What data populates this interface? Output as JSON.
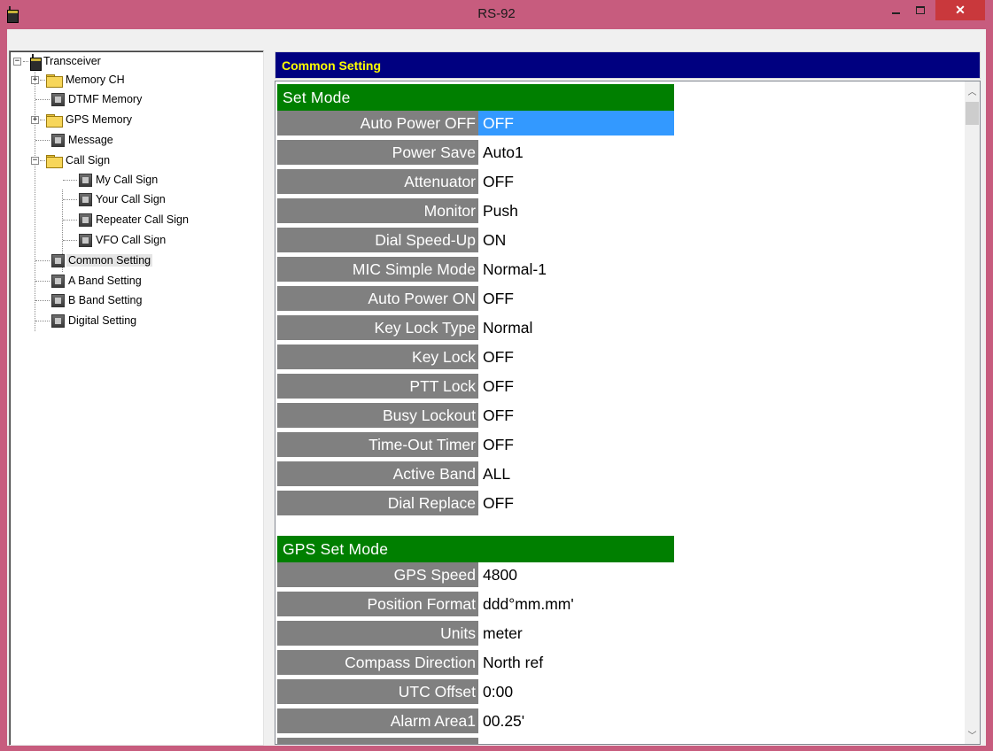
{
  "window": {
    "title": "RS-92"
  },
  "tree": {
    "root": "Transceiver",
    "items": [
      {
        "label": "Memory CH"
      },
      {
        "label": "DTMF Memory"
      },
      {
        "label": "GPS Memory"
      },
      {
        "label": "Message"
      },
      {
        "label": "Call Sign"
      },
      {
        "label": "My Call Sign"
      },
      {
        "label": "Your Call Sign"
      },
      {
        "label": "Repeater Call Sign"
      },
      {
        "label": "VFO Call Sign"
      },
      {
        "label": "Common Setting"
      },
      {
        "label": "A Band Setting"
      },
      {
        "label": "B Band Setting"
      },
      {
        "label": "Digital Setting"
      }
    ],
    "selected": "Common Setting"
  },
  "panel": {
    "header": "Common Setting",
    "sections": [
      {
        "title": "Set Mode",
        "rows": [
          {
            "key": "Auto Power OFF",
            "value": "OFF"
          },
          {
            "key": "Power Save",
            "value": "Auto1"
          },
          {
            "key": "Attenuator",
            "value": "OFF"
          },
          {
            "key": "Monitor",
            "value": "Push"
          },
          {
            "key": "Dial Speed-Up",
            "value": "ON"
          },
          {
            "key": "MIC Simple Mode",
            "value": "Normal-1"
          },
          {
            "key": "Auto Power ON",
            "value": "OFF"
          },
          {
            "key": "Key Lock Type",
            "value": "Normal"
          },
          {
            "key": "Key Lock",
            "value": "OFF"
          },
          {
            "key": "PTT Lock",
            "value": "OFF"
          },
          {
            "key": "Busy Lockout",
            "value": "OFF"
          },
          {
            "key": "Time-Out Timer",
            "value": "OFF"
          },
          {
            "key": "Active Band",
            "value": "ALL"
          },
          {
            "key": "Dial Replace",
            "value": "OFF"
          }
        ]
      },
      {
        "title": "GPS Set Mode",
        "rows": [
          {
            "key": "GPS Speed",
            "value": "4800"
          },
          {
            "key": "Position Format",
            "value": "ddd°mm.mm'"
          },
          {
            "key": "Units",
            "value": "meter"
          },
          {
            "key": "Compass Direction",
            "value": "North ref"
          },
          {
            "key": "UTC Offset",
            "value": "0:00"
          },
          {
            "key": "Alarm Area1",
            "value": "00.25'"
          }
        ]
      }
    ]
  },
  "icons": {
    "app": "radio-icon",
    "minimize": "minimize-icon",
    "maximize": "maximize-icon",
    "close": "close-icon"
  },
  "colors": {
    "title_bar": "#c75c7e",
    "header_bg": "#000080",
    "header_text": "#ffff00",
    "section_bg": "#007f00",
    "label_bg": "#808080",
    "selection": "#3399ff"
  }
}
